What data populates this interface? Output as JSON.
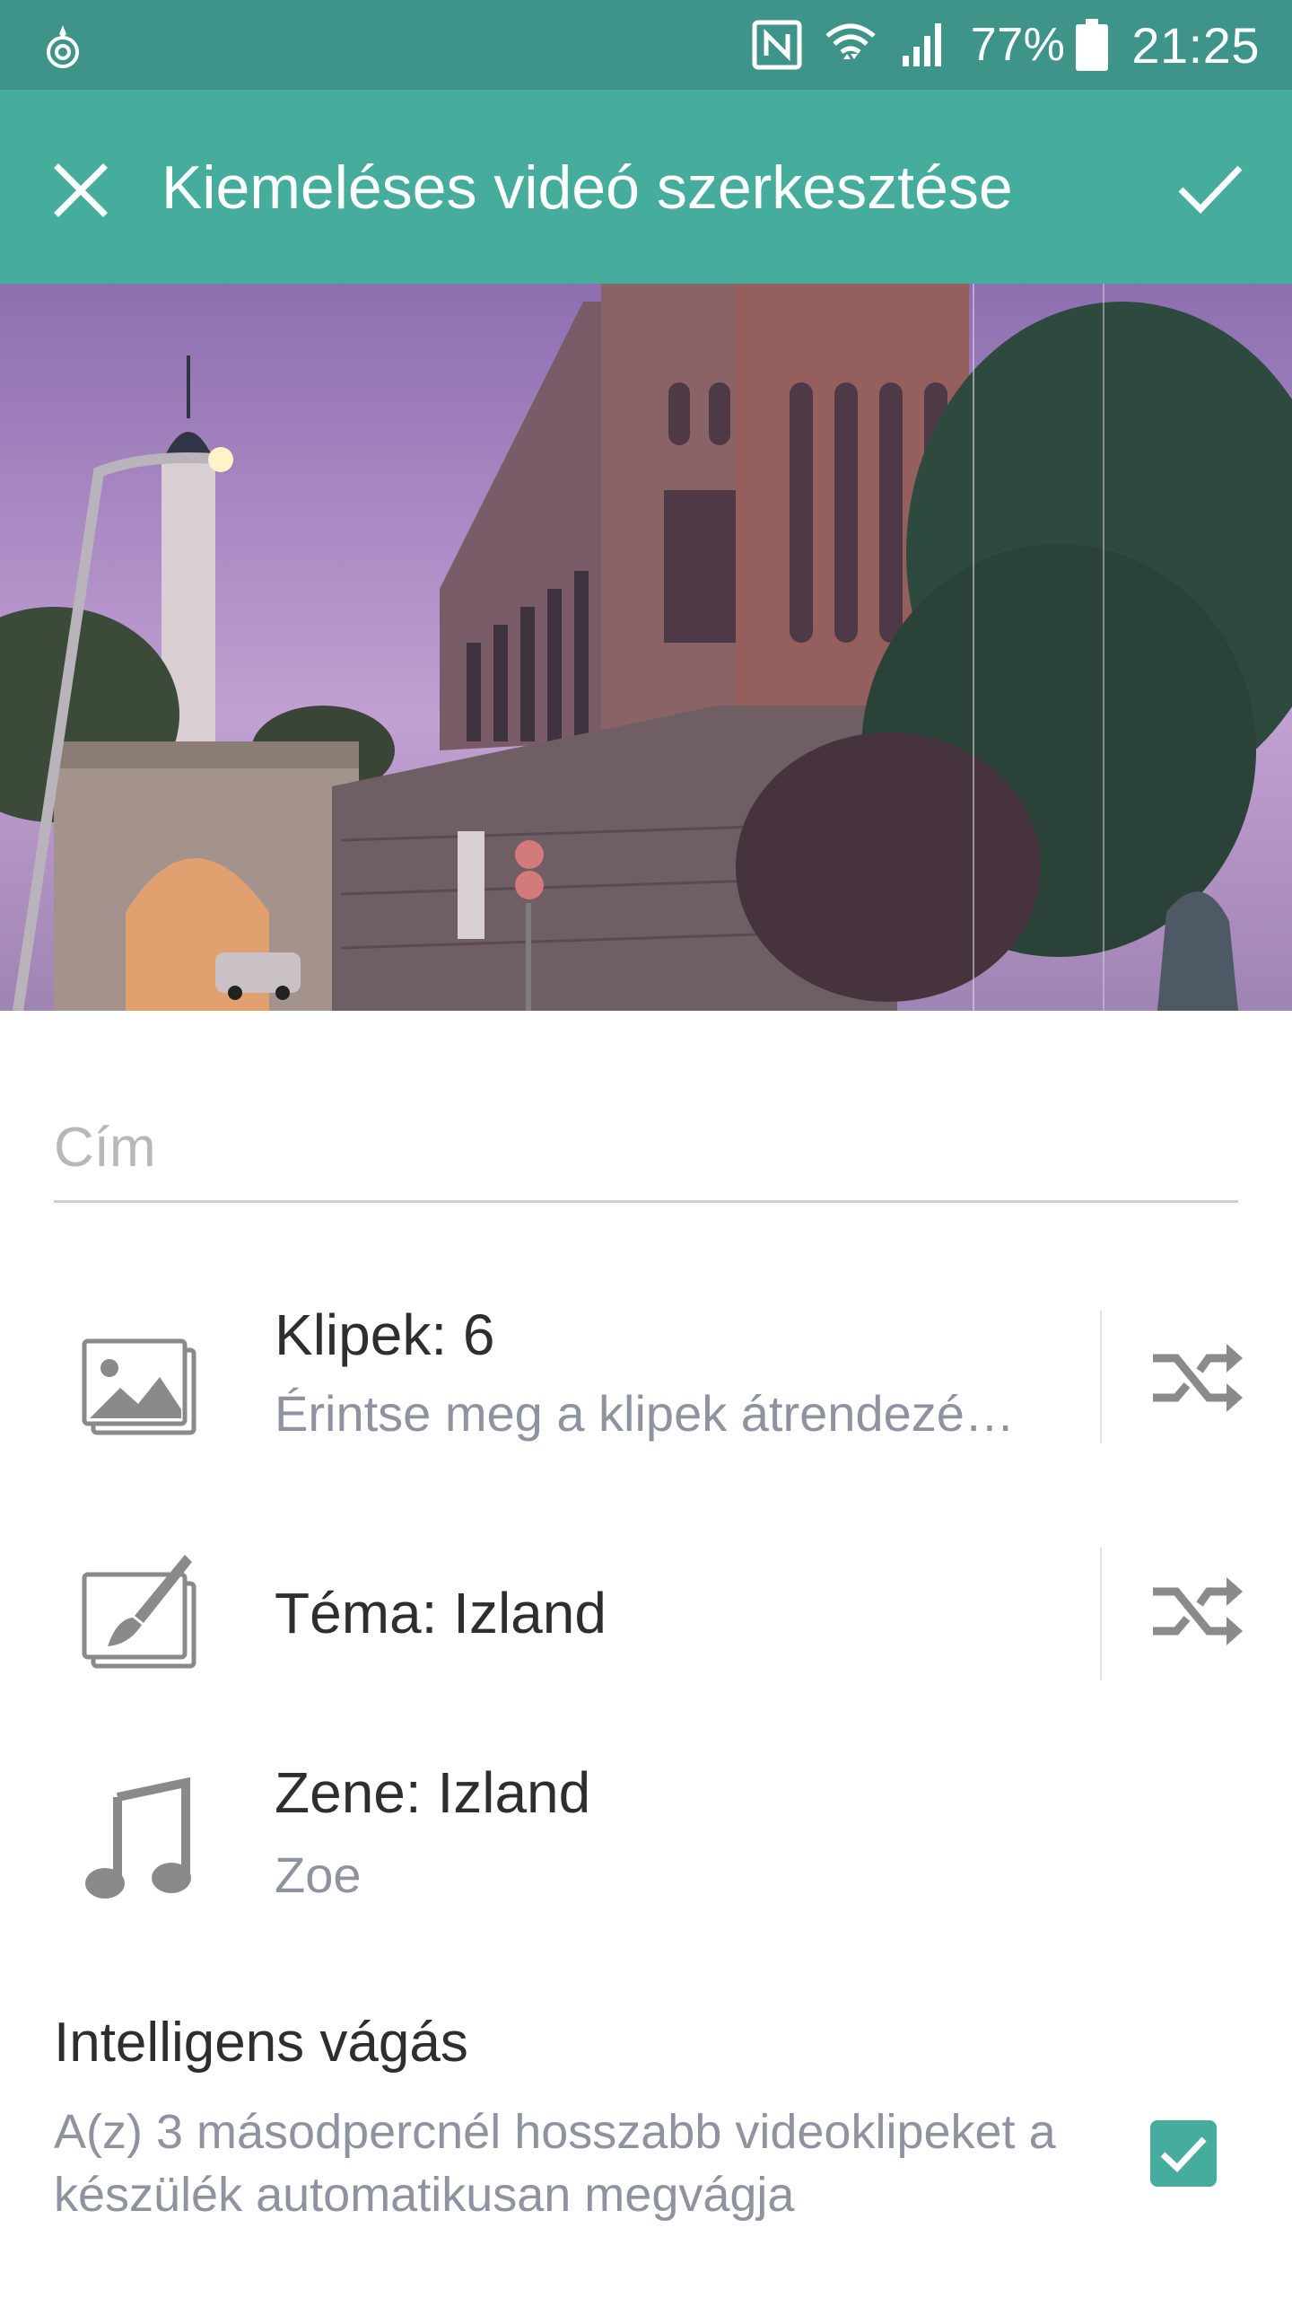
{
  "status_bar": {
    "left_icon": "notification-app-icon",
    "nfc_icon": "nfc-icon",
    "wifi_icon": "wifi-icon",
    "signal_icon": "signal-icon",
    "battery_percent": "77%",
    "battery_icon": "battery-icon",
    "time": "21:25"
  },
  "app_bar": {
    "title": "Kiemeléses videó szerkesztése",
    "close_icon": "close-icon",
    "confirm_icon": "checkmark-icon"
  },
  "title_input": {
    "placeholder": "Cím",
    "value": ""
  },
  "clips": {
    "title": "Klipek: 6",
    "subtitle": "Érintse meg a klipek átrendezé…",
    "icon": "image-stack-icon",
    "shuffle_icon": "shuffle-icon"
  },
  "theme": {
    "title": "Téma: Izland",
    "icon": "paintbrush-canvas-icon",
    "shuffle_icon": "shuffle-icon"
  },
  "music": {
    "title": "Zene: Izland",
    "subtitle": "Zoe",
    "icon": "music-note-icon"
  },
  "smart_cut": {
    "title": "Intelligens vágás",
    "description": "A(z) 3 másodpercnél hosszabb videoklipeket a készülék automatikusan megvágja",
    "checked": true
  },
  "colors": {
    "status_bar": "#3e9488",
    "app_bar": "#46ad9d",
    "accent": "#46ad9d"
  }
}
